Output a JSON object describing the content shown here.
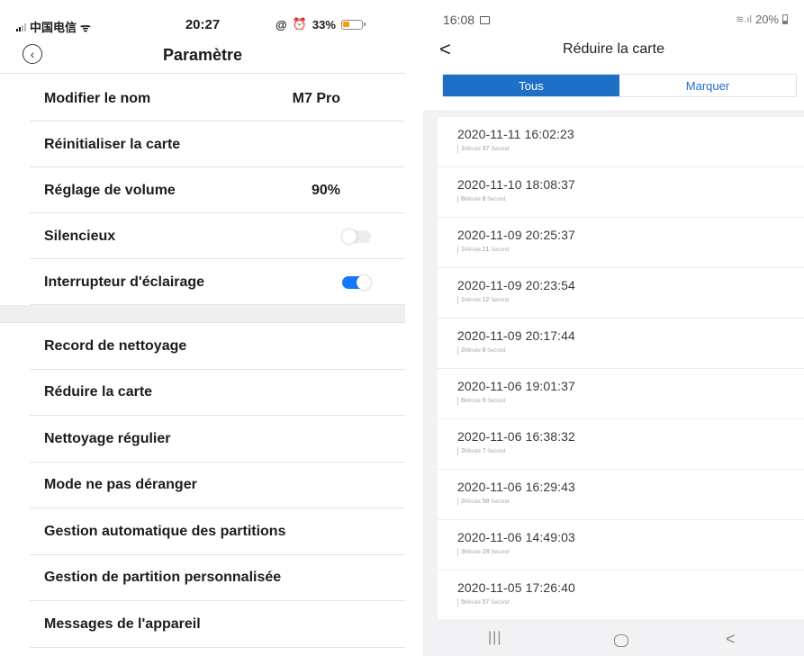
{
  "left_phone": {
    "status": {
      "carrier": "中国电信",
      "time": "20:27",
      "battery_pct": "33%",
      "battery_level": 0.33
    },
    "nav": {
      "title": "Paramètre"
    },
    "settings": [
      {
        "label": "Modifier le nom",
        "value": "M7 Pro"
      },
      {
        "label": "Réinitialiser la carte",
        "value": ""
      },
      {
        "label": "Réglage de volume",
        "value": "90%"
      },
      {
        "label": "Silencieux",
        "toggle": false
      },
      {
        "label": "Interrupteur d'éclairage",
        "toggle": true
      }
    ],
    "settings2": [
      {
        "label": "Record de nettoyage"
      },
      {
        "label": "Réduire la carte"
      },
      {
        "label": "Nettoyage régulier"
      },
      {
        "label": "Mode ne pas déranger"
      },
      {
        "label": "Gestion automatique des partitions"
      },
      {
        "label": "Gestion de partition personnalisée"
      },
      {
        "label": "Messages de l'appareil"
      }
    ]
  },
  "right_phone": {
    "status": {
      "time": "16:08",
      "battery_pct": "20%"
    },
    "nav": {
      "title": "Réduire la carte"
    },
    "tabs": [
      {
        "label": "Tous",
        "active": true
      },
      {
        "label": "Marquer",
        "active": false
      }
    ],
    "records": [
      {
        "datetime": "2020-11-11 16:02:23",
        "min": "1",
        "sec": "37"
      },
      {
        "datetime": "2020-11-10 18:08:37",
        "min": "8",
        "sec": "8"
      },
      {
        "datetime": "2020-11-09 20:25:37",
        "min": "1",
        "sec": "21"
      },
      {
        "datetime": "2020-11-09 20:23:54",
        "min": "1",
        "sec": "12"
      },
      {
        "datetime": "2020-11-09 20:17:44",
        "min": "2",
        "sec": "8"
      },
      {
        "datetime": "2020-11-06 19:01:37",
        "min": "6",
        "sec": "9"
      },
      {
        "datetime": "2020-11-06 16:38:32",
        "min": "2",
        "sec": "7"
      },
      {
        "datetime": "2020-11-06 16:29:43",
        "min": "2",
        "sec": "58"
      },
      {
        "datetime": "2020-11-06 14:49:03",
        "min": "3",
        "sec": "28"
      },
      {
        "datetime": "2020-11-05 17:26:40",
        "min": "5",
        "sec": "57"
      }
    ],
    "duration_units": {
      "minute": "Minute",
      "second": "Second"
    },
    "bottom_nav": {
      "recent_glyph": "|||",
      "back_glyph": "<"
    }
  },
  "colors": {
    "accent_blue": "#1f6fc6",
    "toggle_on": "#1677ff",
    "battery_orange": "#f5a000"
  }
}
